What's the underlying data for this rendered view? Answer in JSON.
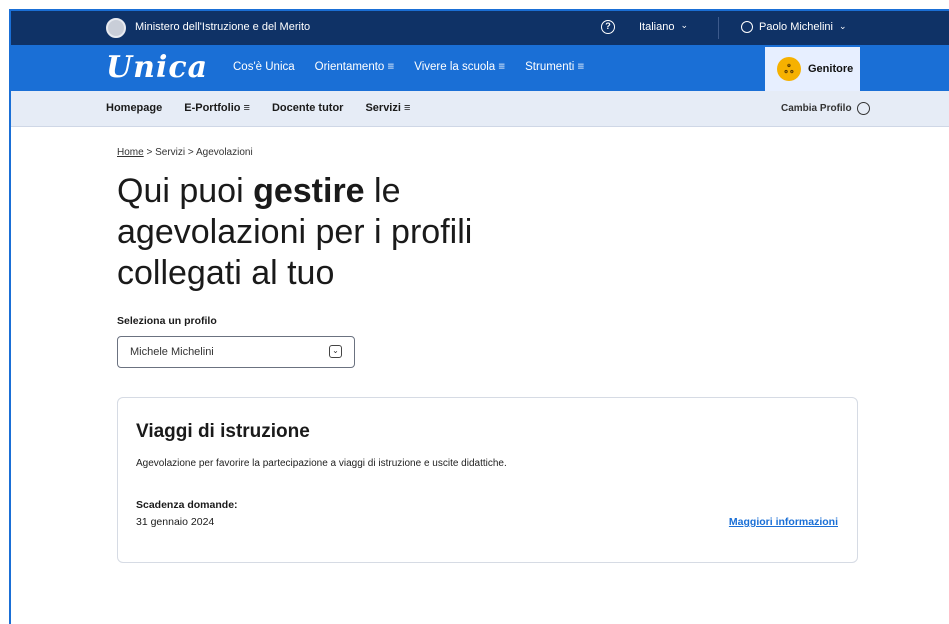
{
  "topbar": {
    "ministry": "Ministero dell'Istruzione e del Merito",
    "help_icon_glyph": "?",
    "language": "Italiano",
    "user_name": "Paolo Michelini"
  },
  "navbar": {
    "logo": "Unica",
    "menu": [
      "Cos'è Unica",
      "Orientamento ≡",
      "Vivere la scuola ≡",
      "Strumenti ≡"
    ],
    "role_label": "Genitore",
    "role_icon_glyph": "ஃ"
  },
  "subnav": {
    "links": [
      "Homepage",
      "E-Portfolio ≡",
      "Docente tutor",
      "Servizi ≡"
    ],
    "switch_label": "Cambia Profilo"
  },
  "breadcrumb": {
    "home": "Home",
    "sep1": " > ",
    "servizi": "Servizi",
    "sep2": " > ",
    "current": "Agevolazioni"
  },
  "hero": {
    "part1": "Qui puoi ",
    "bold": "gestire",
    "part2": " le agevolazioni per i profili collegati al tuo"
  },
  "profile_select": {
    "label": "Seleziona un profilo",
    "value": "Michele Michelini"
  },
  "card": {
    "title": "Viaggi di istruzione",
    "description": "Agevolazione per favorire la partecipazione a viaggi di istruzione e uscite didattiche.",
    "deadline_label": "Scadenza domande:",
    "deadline_date": "31 gennaio 2024",
    "more_link": "Maggiori informazioni"
  },
  "colors": {
    "top_bar": "#0f3266",
    "nav_blue": "#1a6fd6",
    "subnav_bg": "#e6ecf6",
    "role_badge": "#f6b100"
  }
}
